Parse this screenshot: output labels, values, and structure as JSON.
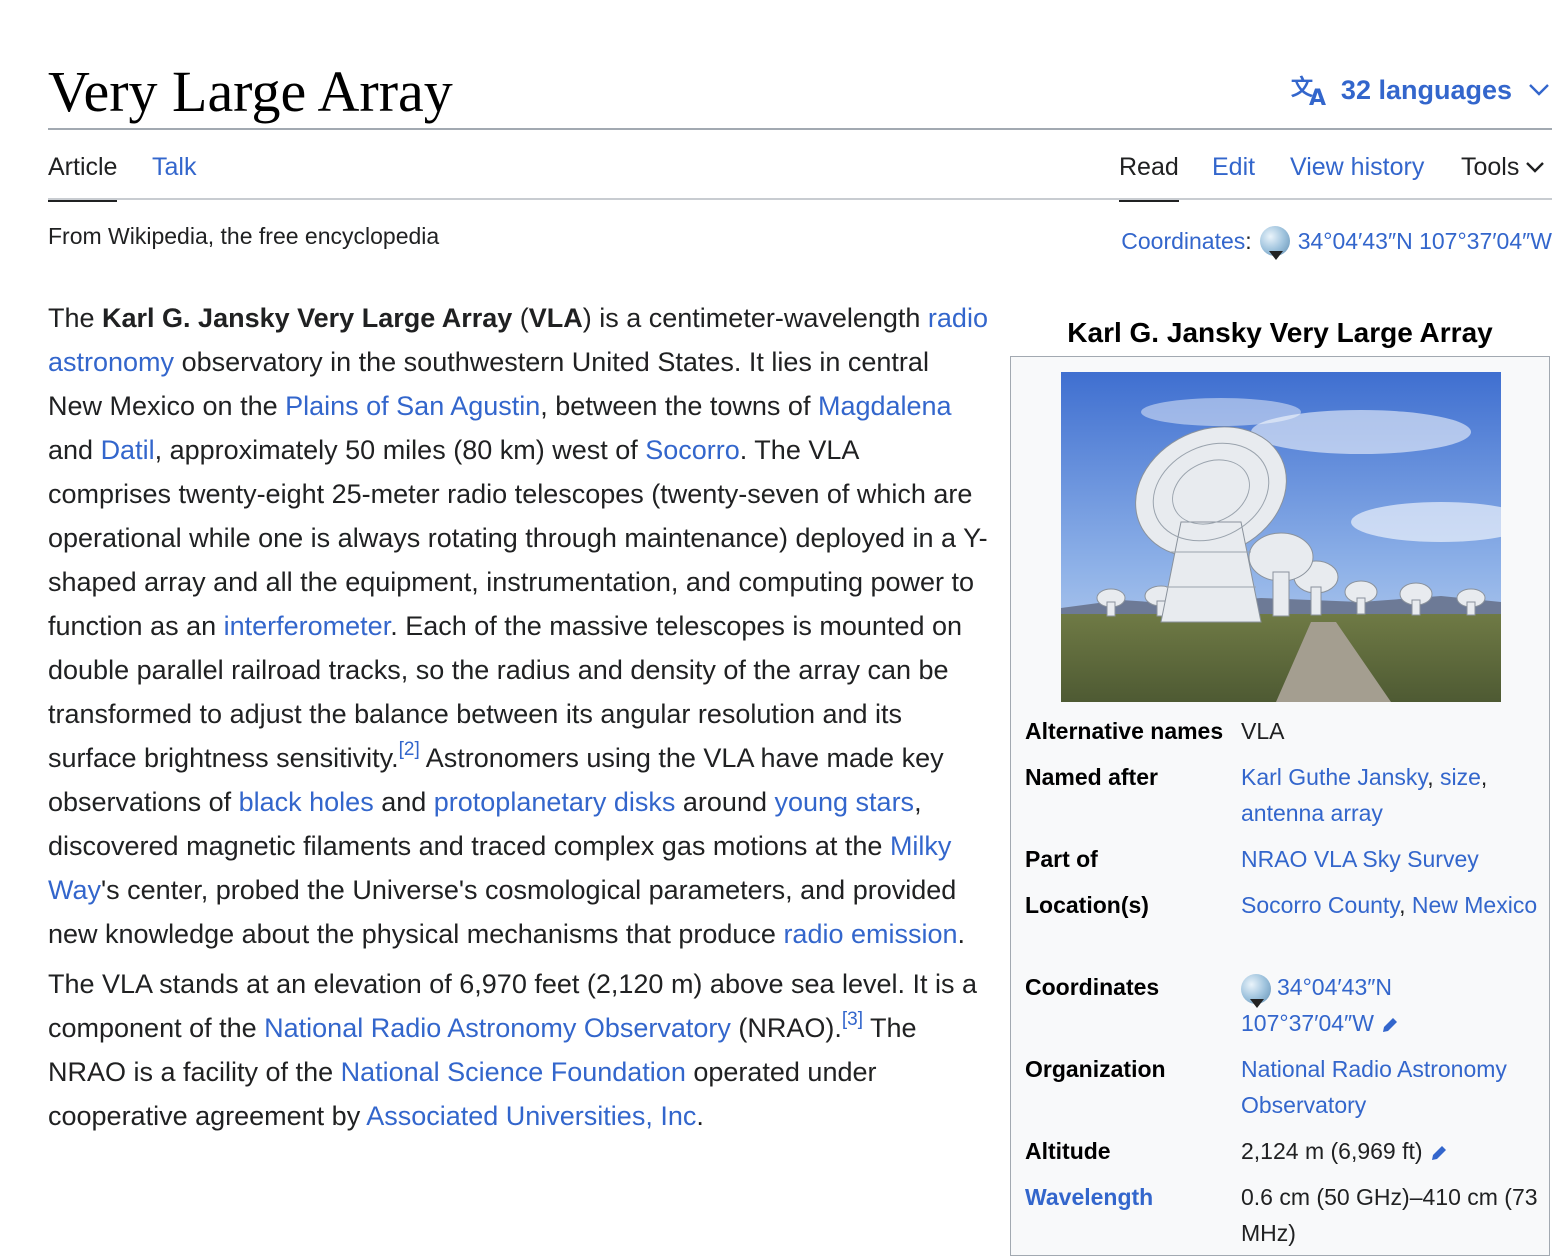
{
  "page": {
    "title": "Very Large Array",
    "languages_label": "32 languages"
  },
  "tabs": {
    "article": "Article",
    "talk": "Talk",
    "read": "Read",
    "edit": "Edit",
    "view_history": "View history",
    "tools": "Tools"
  },
  "tagline": "From Wikipedia, the free encyclopedia",
  "coordinates_top": {
    "label": "Coordinates",
    "separator": ":",
    "value": "34°04′43″N 107°37′04″W"
  },
  "article": {
    "p1": {
      "t1": "The ",
      "b1": "Karl G. Jansky Very Large Array",
      "t2": " (",
      "b2": "VLA",
      "t3": ") is a centimeter-wavelength ",
      "l1": "radio astronomy",
      "t4": " observatory in the southwestern United States. It lies in central New Mexico on the ",
      "l2": "Plains of San Agustin",
      "t5": ", between the towns of ",
      "l3": "Magdalena",
      "t6": " and ",
      "l4": "Datil",
      "t7": ", approximately 50 miles (80 km) west of ",
      "l5": "Socorro",
      "t8": ". The VLA comprises twenty-eight 25-meter radio telescopes (twenty-seven of which are operational while one is always rotating through maintenance) deployed in a Y-shaped array and all the equipment, instrumentation, and computing power to function as an ",
      "l6": "interferometer",
      "t9": ". Each of the massive telescopes is mounted on double parallel railroad tracks, so the radius and density of the array can be transformed to adjust the balance between its angular resolution and its surface brightness sensitivity.",
      "ref1": "[2]",
      "t10": " Astronomers using the VLA have made key observations of ",
      "l7": "black holes",
      "t11": " and ",
      "l8": "protoplanetary disks",
      "t12": " around ",
      "l9": "young stars",
      "t13": ", discovered magnetic filaments and traced complex gas motions at the ",
      "l10": "Milky Way",
      "t14": "'s center, probed the Universe's cosmological parameters, and provided new knowledge about the physical mechanisms that produce ",
      "l11": "radio emission",
      "t15": "."
    },
    "p2": {
      "t1": "The VLA stands at an elevation of 6,970 feet (2,120 m) above sea level. It is a component of the ",
      "l1": "National Radio Astronomy Observatory",
      "t2": " (NRAO).",
      "ref1": "[3]",
      "t3": " The NRAO is a facility of the ",
      "l2": "National Science Foundation",
      "t4": " operated under cooperative agreement by ",
      "l3": "Associated Universities, Inc",
      "t5": "."
    }
  },
  "infobox": {
    "caption": "Karl G. Jansky Very Large Array",
    "rows": {
      "alt_names": {
        "label": "Alternative names",
        "value": "VLA"
      },
      "named_after": {
        "label": "Named after",
        "link1": "Karl Guthe Jansky",
        "sep1": ", ",
        "link2": "size",
        "sep2": ", ",
        "link3": "antenna array"
      },
      "part_of": {
        "label": "Part of",
        "link1": "NRAO VLA Sky Survey"
      },
      "location": {
        "label": "Location(s)",
        "link1": "Socorro County",
        "sep1": ", ",
        "link2": "New Mexico"
      },
      "coordinates": {
        "label": "Coordinates",
        "value": "34°04′43″N 107°37′04″W"
      },
      "organization": {
        "label": "Organization",
        "link1": "National Radio Astronomy Observatory"
      },
      "altitude": {
        "label": "Altitude",
        "value": "2,124 m (6,969 ft)"
      },
      "wavelength": {
        "label": "Wavelength",
        "value": "0.6 cm (50 GHz)–410 cm (73 MHz)"
      }
    }
  },
  "icons": {
    "translate": "translate-icon",
    "chevron": "chevron-down-icon",
    "globe": "globe-icon",
    "pencil": "pencil-icon"
  },
  "colors": {
    "link": "#3366cc",
    "text": "#202122",
    "infobox_bg": "#f8f9fa",
    "border": "#a2a9b1"
  }
}
